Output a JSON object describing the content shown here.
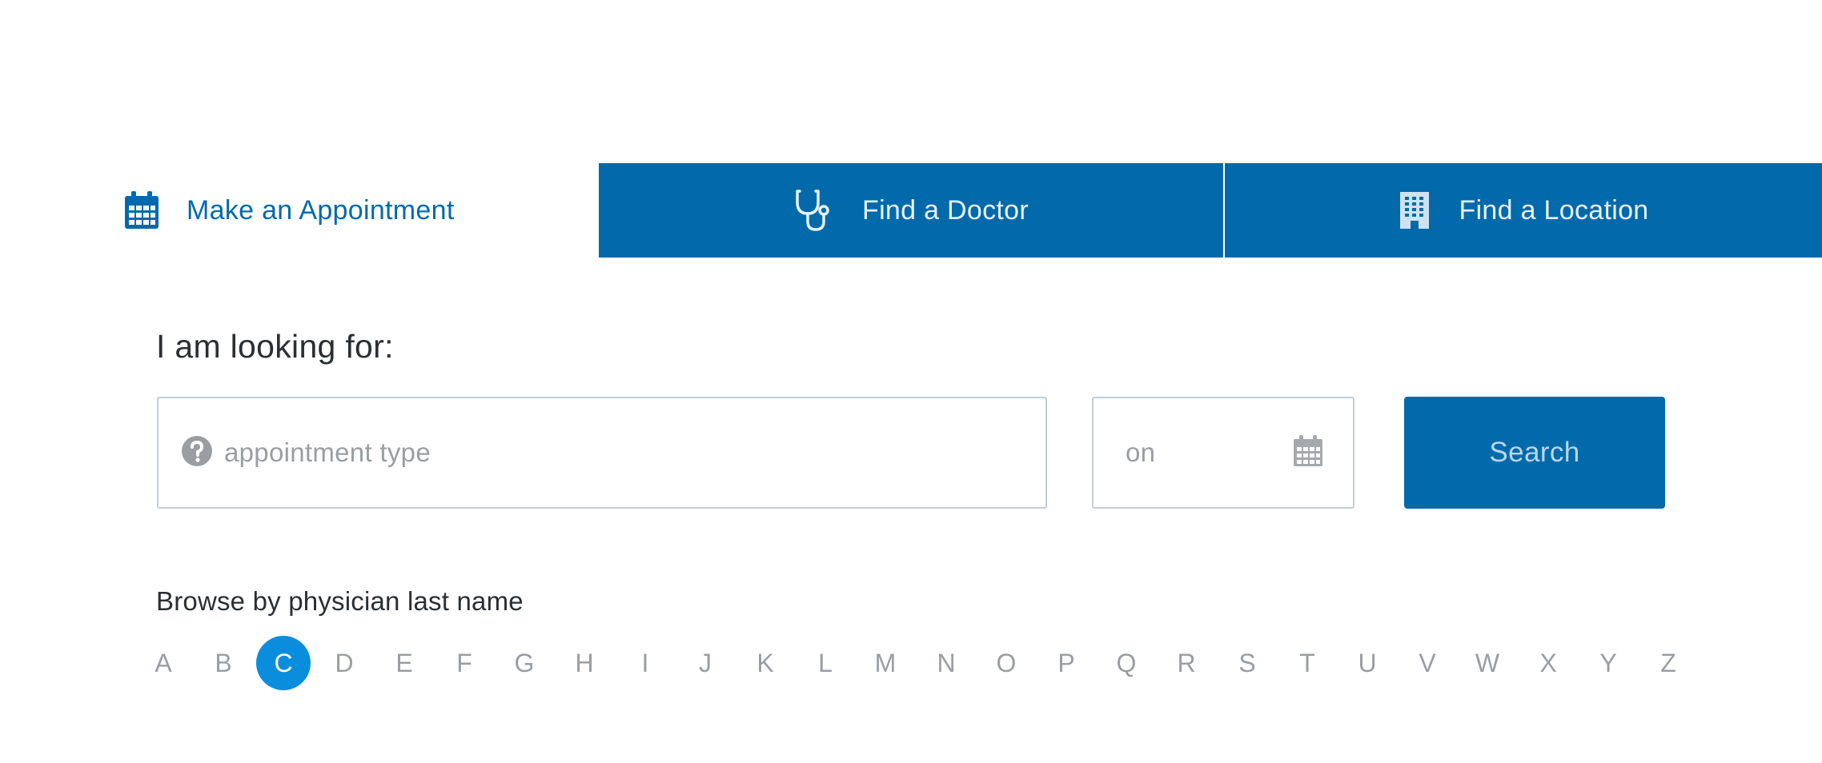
{
  "tabs": {
    "appointment": {
      "label": "Make an Appointment",
      "icon": "calendar-icon"
    },
    "doctor": {
      "label": "Find a Doctor",
      "icon": "stethoscope-icon"
    },
    "location": {
      "label": "Find a Location",
      "icon": "building-icon"
    }
  },
  "search": {
    "heading": "I am looking for:",
    "type_placeholder": "appointment type",
    "type_icon": "question-icon",
    "date_placeholder": "on",
    "date_icon": "calendar-icon",
    "button_label": "Search"
  },
  "browse": {
    "label": "Browse by physician last name",
    "active_letter": "C",
    "letters": [
      "A",
      "B",
      "C",
      "D",
      "E",
      "F",
      "G",
      "H",
      "I",
      "J",
      "K",
      "L",
      "M",
      "N",
      "O",
      "P",
      "Q",
      "R",
      "S",
      "T",
      "U",
      "V",
      "W",
      "X",
      "Y",
      "Z"
    ]
  },
  "colors": {
    "brand_blue": "#026aab",
    "active_circle": "#0a8ddc",
    "muted_text": "#9a9ea2"
  }
}
